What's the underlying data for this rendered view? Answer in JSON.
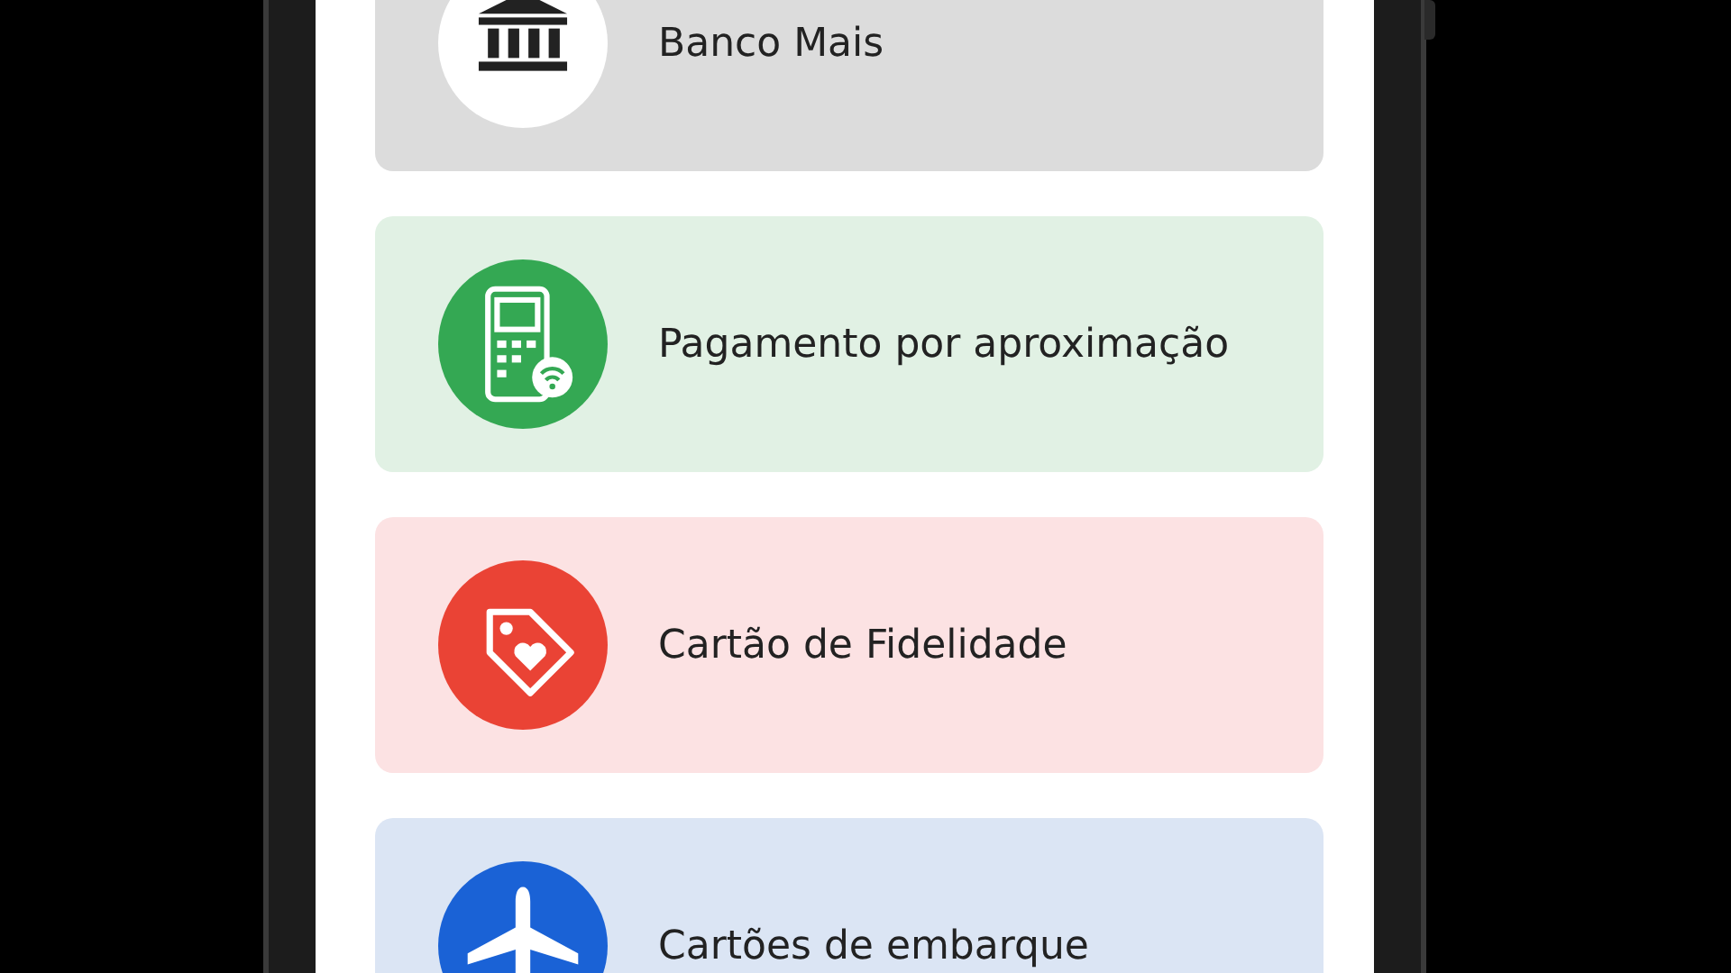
{
  "cards": [
    {
      "title": "Banco Mais",
      "kind": "bank",
      "color": "#dcdcdc"
    },
    {
      "title": "Pagamento por aproximação",
      "kind": "terminal",
      "color": "#e1f1e4"
    },
    {
      "title": "Cartão de Fidelidade",
      "kind": "tag",
      "color": "#fce2e3"
    },
    {
      "title": "Cartões de embarque",
      "kind": "plane",
      "color": "#dbe5f4"
    }
  ]
}
